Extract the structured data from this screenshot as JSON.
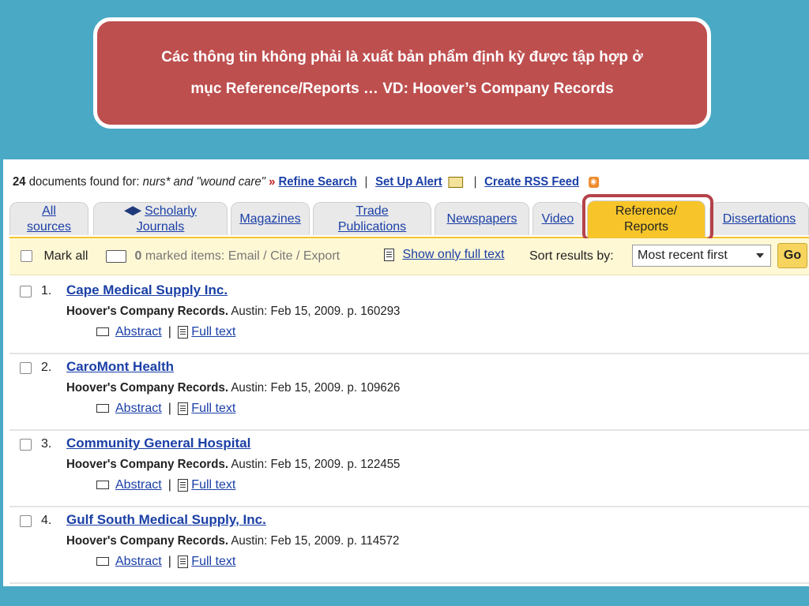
{
  "callout": {
    "line1": "Các thông tin không phải là xuất bản phẩm định kỳ được tập hợp ở",
    "line2": "mục Reference/Reports …  VD: Hoover’s Company Records"
  },
  "summary": {
    "count": "24",
    "found_text": "documents found for:",
    "query": "nurs* and \"wound care\"",
    "arrows": "»",
    "refine_label": "Refine Search",
    "separator": "|",
    "alert_label": "Set Up Alert",
    "rss_label": "Create RSS Feed"
  },
  "tabs": [
    {
      "line1": "All",
      "line2": "sources"
    },
    {
      "line1": "Scholarly",
      "line2": "Journals"
    },
    {
      "line1": "Magazines",
      "line2": ""
    },
    {
      "line1": "Trade",
      "line2": "Publications"
    },
    {
      "line1": "Newspapers",
      "line2": ""
    },
    {
      "line1": "Video",
      "line2": ""
    },
    {
      "line1": "Reference/",
      "line2": "Reports"
    },
    {
      "line1": "Dissertations",
      "line2": ""
    }
  ],
  "toolbar": {
    "mark_all": "Mark all",
    "marked_count": "0",
    "marked_text": "marked items: Email / Cite / Export",
    "full_text_only": "Show only full text",
    "sort_label": "Sort results by:",
    "sort_value": "Most recent first",
    "go_label": "Go"
  },
  "results": [
    {
      "num": "1.",
      "title": "Cape Medical Supply Inc.",
      "publication": "Hoover's Company Records.",
      "details": "Austin: Feb 15, 2009. p. 160293",
      "abstract": "Abstract",
      "fulltext": "Full text"
    },
    {
      "num": "2.",
      "title": "CaroMont Health",
      "publication": "Hoover's Company Records.",
      "details": "Austin: Feb 15, 2009. p. 109626",
      "abstract": "Abstract",
      "fulltext": "Full text"
    },
    {
      "num": "3.",
      "title": "Community General Hospital",
      "publication": "Hoover's Company Records.",
      "details": "Austin: Feb 15, 2009. p. 122455",
      "abstract": "Abstract",
      "fulltext": "Full text"
    },
    {
      "num": "4.",
      "title": "Gulf South Medical Supply, Inc.",
      "publication": "Hoover's Company Records.",
      "details": "Austin: Feb 15, 2009. p. 114572",
      "abstract": "Abstract",
      "fulltext": "Full text"
    }
  ],
  "colors": {
    "background": "#4aa9c4",
    "callout": "#be4f4f",
    "active_tab": "#f7c52a",
    "link": "#1a3fa6",
    "highlight": "#b5424a"
  }
}
